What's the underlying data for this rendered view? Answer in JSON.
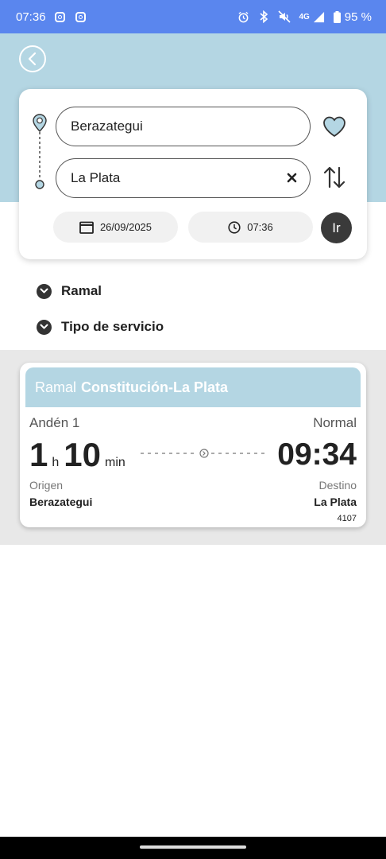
{
  "status_bar": {
    "time": "07:36",
    "network": "4G",
    "battery": "95 %",
    "bg_color": "#5a86ee",
    "icons": [
      "instagram-icon",
      "instagram-icon",
      "alarm-icon",
      "bluetooth-icon",
      "mute-icon",
      "signal-icon",
      "battery-icon"
    ]
  },
  "search": {
    "origin": "Berazategui",
    "destination": "La Plata",
    "date": "26/09/2025",
    "time": "07:36",
    "go_label": "Ir"
  },
  "filters": {
    "ramal_label": "Ramal",
    "tipo_label": "Tipo de servicio"
  },
  "results": [
    {
      "ramal_prefix": "Ramal",
      "ramal_name": "Constitución-La Plata",
      "platform": "Andén 1",
      "service": "Normal",
      "duration_hours": "1",
      "hours_unit": "h",
      "duration_minutes": "10",
      "minutes_unit": "min",
      "arrival": "09:34",
      "origin_label": "Origen",
      "origin": "Berazategui",
      "destination_label": "Destino",
      "destination": "La Plata",
      "train_number": "4107"
    }
  ],
  "colors": {
    "accent": "#b4d6e3",
    "dark": "#3a3a3a",
    "results_bg": "#e8e8e8"
  }
}
